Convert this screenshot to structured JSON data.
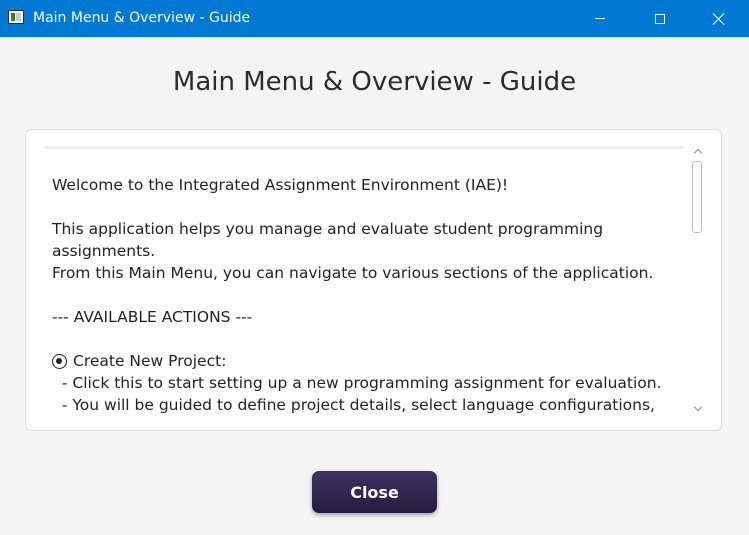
{
  "window": {
    "title": "Main Menu & Overview - Guide",
    "controls": [
      "minimize",
      "maximize",
      "close"
    ],
    "titlebar_color": "#0078d4"
  },
  "page": {
    "heading": "Main Menu & Overview - Guide"
  },
  "guide": {
    "welcome": "Welcome to the Integrated Assignment Environment (IAE)!",
    "intro_line1": "This application helps you manage and evaluate student programming",
    "intro_line2": "assignments.",
    "intro_line3": "From this Main Menu, you can navigate to various sections of the application.",
    "section_header": "--- AVAILABLE ACTIONS ---",
    "action1_title": "Create New Project:",
    "action1_line1": "  - Click this to start setting up a new programming assignment for evaluation.",
    "action1_line2": "  - You will be guided to define project details, select language configurations,",
    "action1_icon": "radio-selected-icon"
  },
  "footer": {
    "close_label": "Close",
    "close_button_color": "#2f2850"
  }
}
